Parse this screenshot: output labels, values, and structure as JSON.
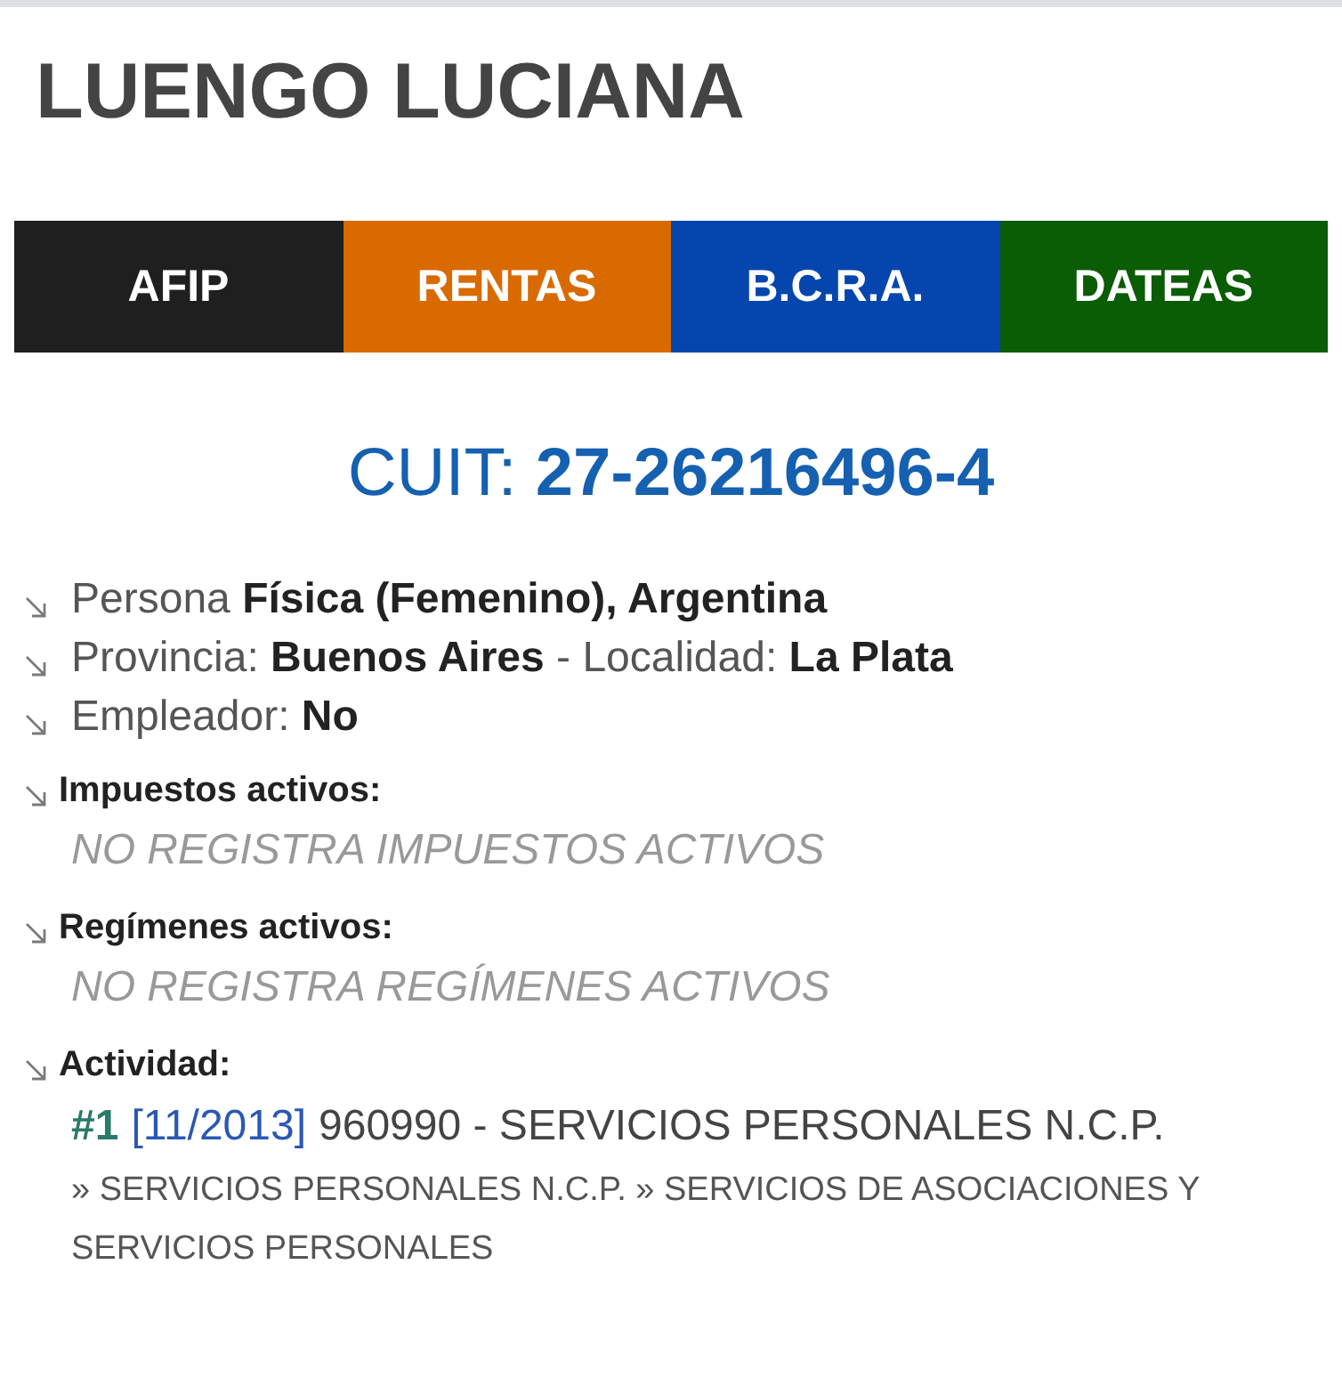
{
  "title": "LUENGO LUCIANA",
  "tabs": [
    {
      "label": "AFIP",
      "color": "#1f1f1f"
    },
    {
      "label": "RENTAS",
      "color": "#d96a00"
    },
    {
      "label": "B.C.R.A.",
      "color": "#0446ad"
    },
    {
      "label": "DATEAS",
      "color": "#0a5c05"
    }
  ],
  "cuit": "CUIT: **27-26216496-4**",
  "details": [
    "Persona **Física (Femenino), Argentina**",
    "Provincia: **Buenos Aires** - Localidad: **La Plata**",
    "Empleador: **No**"
  ],
  "sections": [
    {
      "kind": "notice",
      "heading": "Impuestos activos:",
      "text": "NO REGISTRA IMPUESTOS ACTIVOS"
    },
    {
      "kind": "notice",
      "heading": "Regímenes activos:",
      "text": "NO REGISTRA REGÍMENES ACTIVOS"
    },
    {
      "kind": "activities",
      "heading": "Actividad:",
      "activities": [
        {
          "number": "#1",
          "period": "[11/2013]",
          "description": "960990 - SERVICIOS PERSONALES N.C.P.",
          "path": "» SERVICIOS PERSONALES N.C.P. » SERVICIOS DE ASOCIACIONES Y SERVICIOS PERSONALES"
        }
      ]
    }
  ]
}
